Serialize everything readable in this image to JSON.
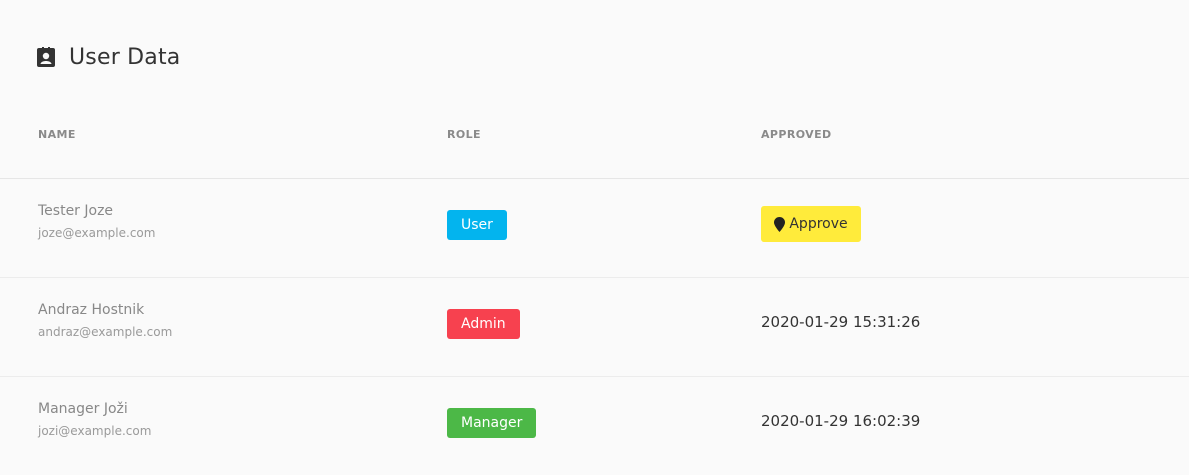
{
  "header": {
    "title": "User Data",
    "icon": "contact-card-icon"
  },
  "table": {
    "columns": {
      "name": "NAME",
      "role": "ROLE",
      "approved": "APPROVED"
    },
    "rows": [
      {
        "name": "Tester Joze",
        "email": "joze@example.com",
        "role": "User",
        "role_color": "#03b4ee",
        "approved": "",
        "approve_label": "Approve"
      },
      {
        "name": "Andraz Hostnik",
        "email": "andraz@example.com",
        "role": "Admin",
        "role_color": "#f7414f",
        "approved": "2020-01-29 15:31:26"
      },
      {
        "name": "Manager Joži",
        "email": "jozi@example.com",
        "role": "Manager",
        "role_color": "#4cb847",
        "approved": "2020-01-29 16:02:39"
      }
    ]
  },
  "colors": {
    "approve_button": "#ffeb3b"
  }
}
